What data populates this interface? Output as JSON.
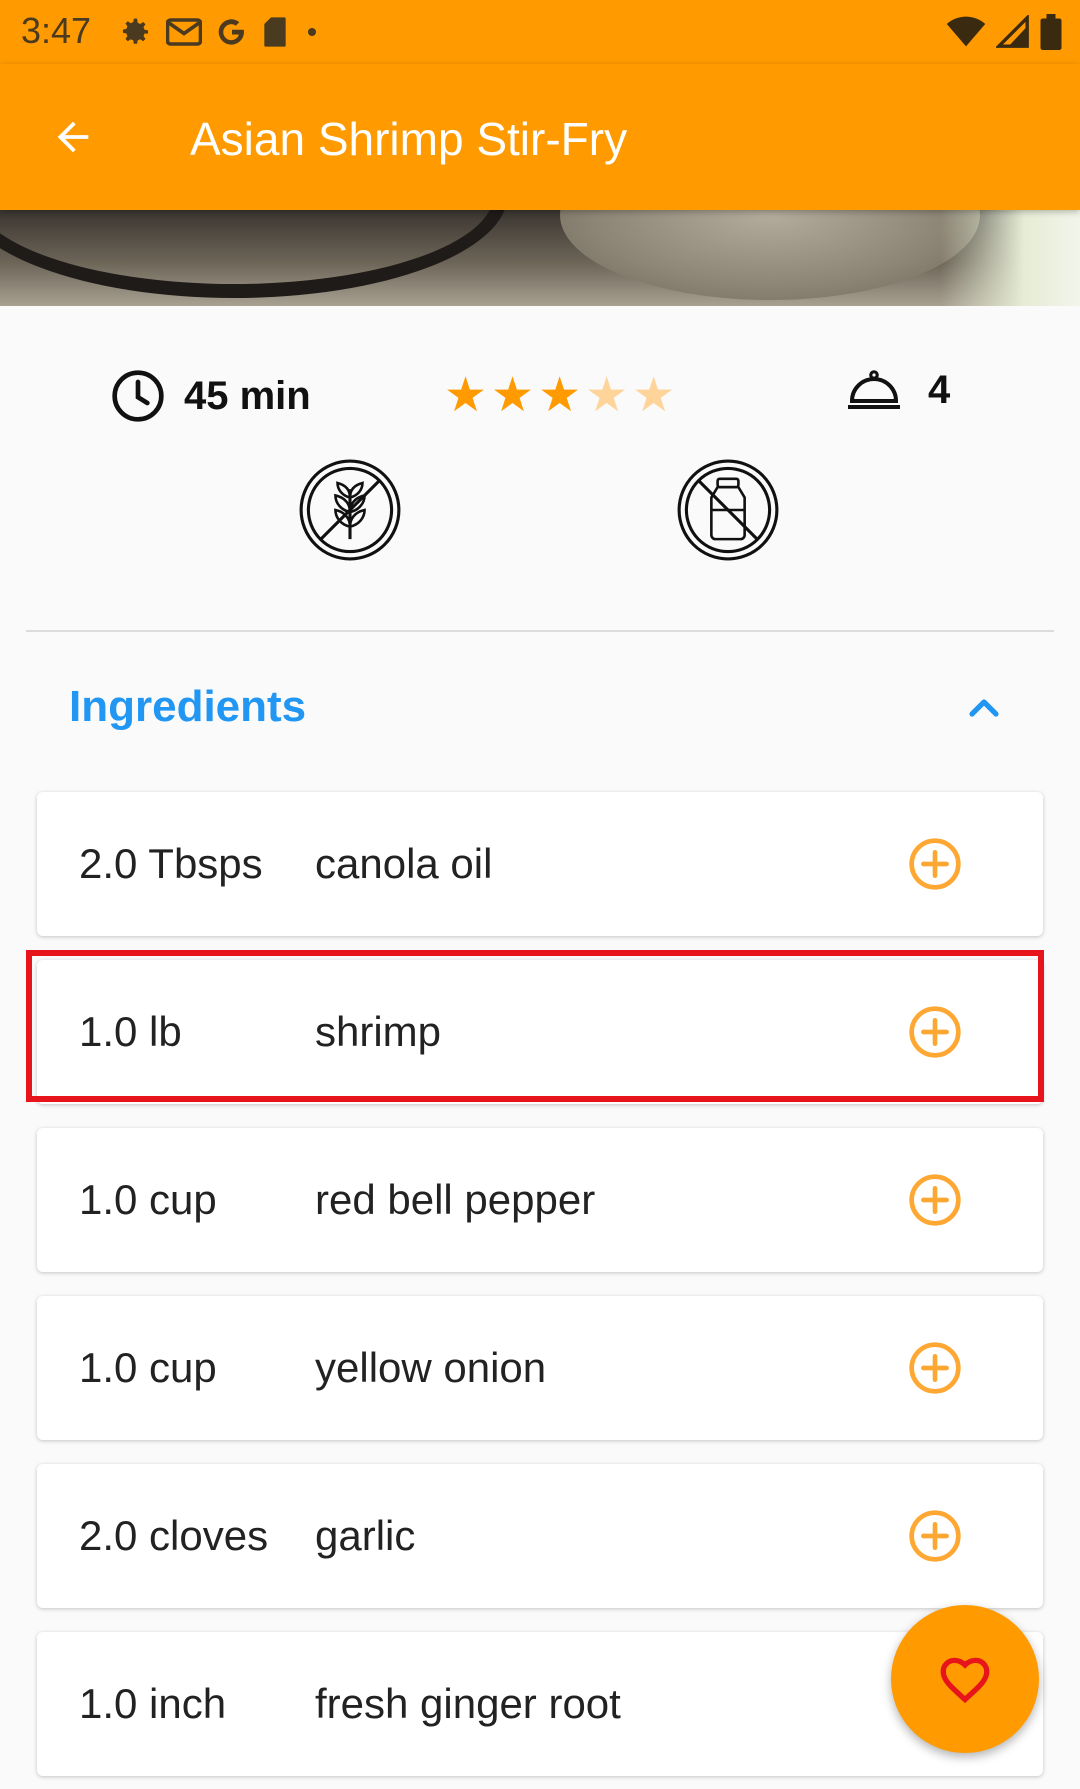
{
  "status_bar": {
    "time": "3:47",
    "icons_left": [
      "settings-icon",
      "gmail-icon",
      "google-icon",
      "sd-card-icon",
      "dot-icon"
    ],
    "icons_right": [
      "wifi-icon",
      "signal-icon",
      "battery-icon"
    ]
  },
  "app_bar": {
    "title": "Asian Shrimp Stir-Fry",
    "back_icon": "arrow-back-icon"
  },
  "recipe_stats": {
    "time_label": "45 min",
    "rating": 3,
    "rating_max": 5,
    "servings": "4"
  },
  "diet_badges": [
    "gluten-free-icon",
    "dairy-free-icon"
  ],
  "ingredients_section": {
    "title": "Ingredients",
    "expanded": true,
    "items": [
      {
        "qty": "2.0 Tbsps",
        "name": "canola oil"
      },
      {
        "qty": "1.0 lb",
        "name": "shrimp"
      },
      {
        "qty": "1.0 cup",
        "name": "red bell pepper"
      },
      {
        "qty": "1.0 cup",
        "name": "yellow onion"
      },
      {
        "qty": "2.0 cloves",
        "name": "garlic"
      },
      {
        "qty": "1.0 inch",
        "name": "fresh ginger root"
      }
    ]
  },
  "fab": {
    "icon": "heart-icon"
  },
  "colors": {
    "primary": "#ff9a00",
    "accent_blue": "#2196f3",
    "add_icon": "#ffa733",
    "star_filled": "#ff9a00",
    "star_empty": "#ffd49a",
    "highlight": "#e8141c"
  }
}
